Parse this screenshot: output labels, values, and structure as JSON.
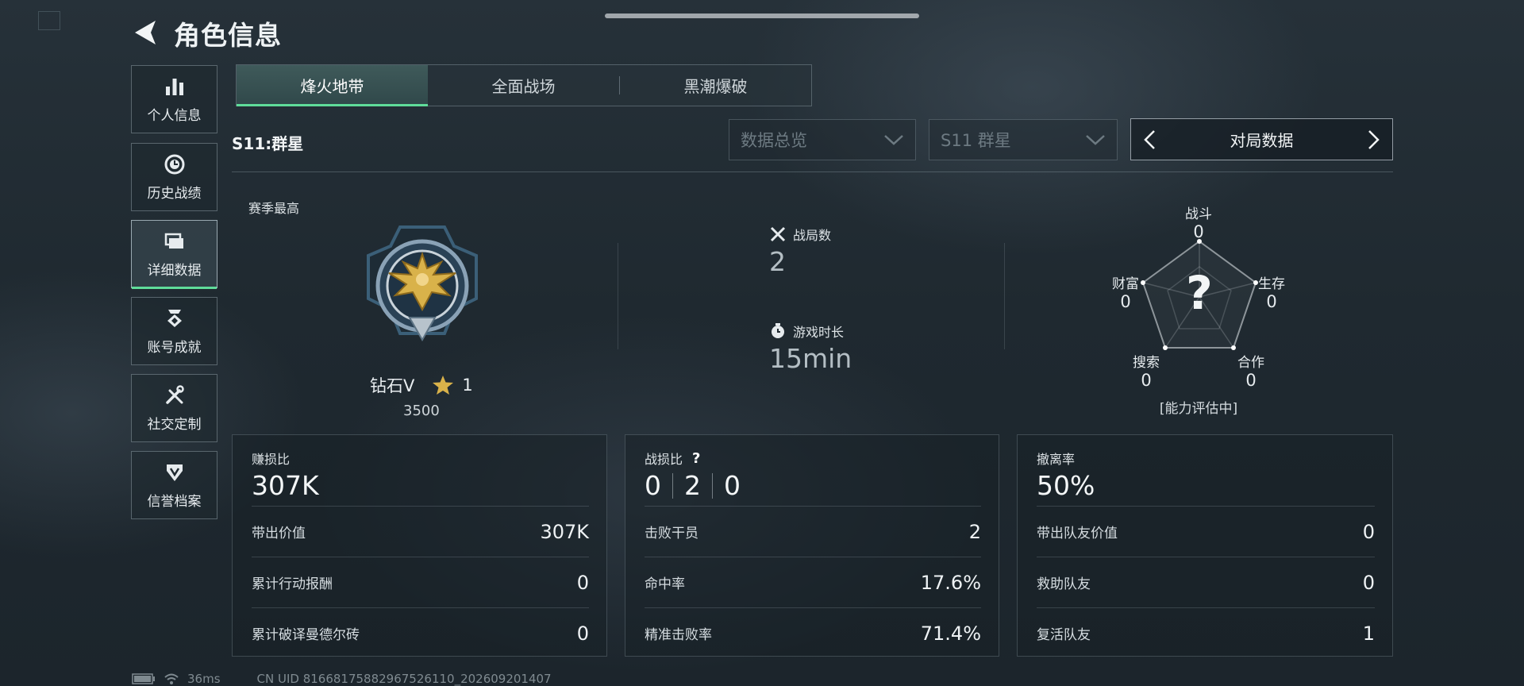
{
  "header": {
    "title": "角色信息"
  },
  "sidebar": {
    "items": [
      {
        "label": "个人信息",
        "icon": "bar-chart-icon"
      },
      {
        "label": "历史战绩",
        "icon": "clock-icon"
      },
      {
        "label": "详细数据",
        "icon": "cards-icon",
        "active": true
      },
      {
        "label": "账号成就",
        "icon": "medal-icon"
      },
      {
        "label": "社交定制",
        "icon": "tools-icon"
      },
      {
        "label": "信誉档案",
        "icon": "shield-icon"
      }
    ]
  },
  "tabs": [
    {
      "label": "烽火地带",
      "active": true
    },
    {
      "label": "全面战场"
    },
    {
      "label": "黑潮爆破"
    }
  ],
  "season_label": "S11:群星",
  "filters": {
    "view_select": "数据总览",
    "season_select": "S11 群星",
    "pager_label": "对局数据"
  },
  "rank": {
    "section_title": "赛季最高",
    "name": "钻石V",
    "stars": "1",
    "score": "3500"
  },
  "matches": {
    "label": "战局数",
    "value": "2"
  },
  "playtime": {
    "label": "游戏时长",
    "value": "15min"
  },
  "radar": {
    "center": "?",
    "note": "[能力评估中]",
    "axes": [
      {
        "label": "战斗",
        "value": "0"
      },
      {
        "label": "生存",
        "value": "0"
      },
      {
        "label": "合作",
        "value": "0"
      },
      {
        "label": "搜索",
        "value": "0"
      },
      {
        "label": "财富",
        "value": "0"
      }
    ]
  },
  "cards": [
    {
      "title": "赚损比",
      "value": "307K",
      "rows": [
        {
          "label": "带出价值",
          "value": "307K"
        },
        {
          "label": "累计行动报酬",
          "value": "0"
        },
        {
          "label": "累计破译曼德尔砖",
          "value": "0"
        }
      ]
    },
    {
      "title": "战损比",
      "help": "?",
      "kda": [
        "0",
        "2",
        "0"
      ],
      "rows": [
        {
          "label": "击败干员",
          "value": "2"
        },
        {
          "label": "命中率",
          "value": "17.6%"
        },
        {
          "label": "精准击败率",
          "value": "71.4%"
        }
      ]
    },
    {
      "title": "撤离率",
      "value": "50%",
      "rows": [
        {
          "label": "带出队友价值",
          "value": "0"
        },
        {
          "label": "救助队友",
          "value": "0"
        },
        {
          "label": "复活队友",
          "value": "1"
        }
      ]
    }
  ],
  "status": {
    "ping": "36ms",
    "uid": "CN UID 8166817588296752​6110_202609201407"
  },
  "colors": {
    "accent": "#5fdc9a",
    "gold": "#d9b24a"
  }
}
